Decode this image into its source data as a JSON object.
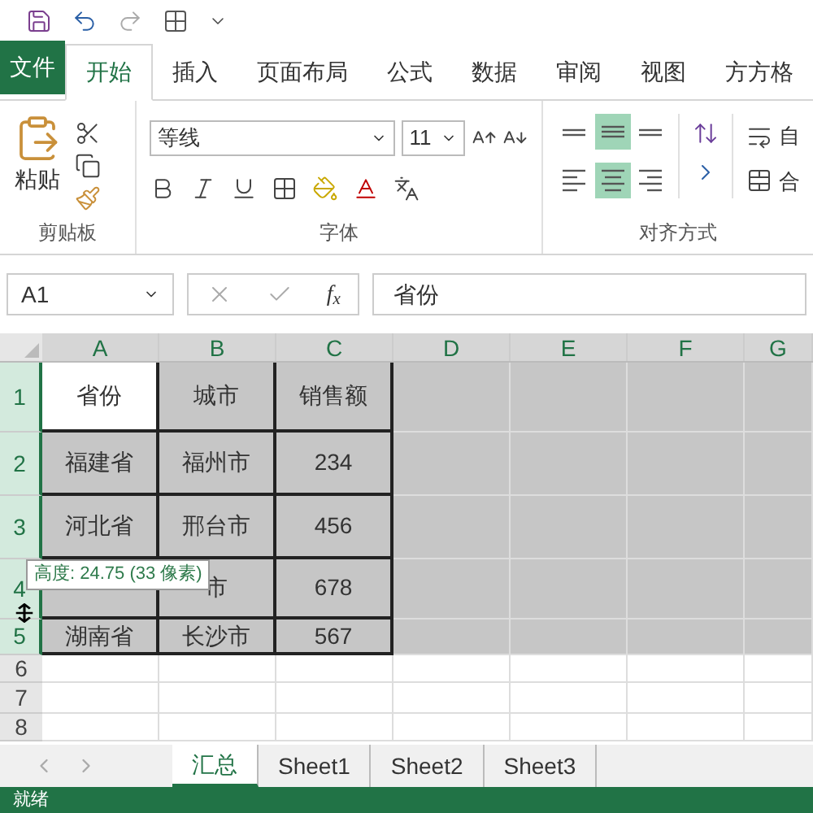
{
  "ribbon_tabs": [
    {
      "label": "文件",
      "kind": "file",
      "selected": false
    },
    {
      "label": "开始",
      "kind": "tab",
      "selected": true
    },
    {
      "label": "插入",
      "kind": "tab",
      "selected": false
    },
    {
      "label": "页面布局",
      "kind": "tab",
      "selected": false
    },
    {
      "label": "公式",
      "kind": "tab",
      "selected": false
    },
    {
      "label": "数据",
      "kind": "tab",
      "selected": false
    },
    {
      "label": "审阅",
      "kind": "tab",
      "selected": false
    },
    {
      "label": "视图",
      "kind": "tab",
      "selected": false
    },
    {
      "label": "方方格",
      "kind": "tab",
      "selected": false
    }
  ],
  "clipboard": {
    "paste_label": "粘贴",
    "group_label": "剪贴板"
  },
  "font": {
    "name": "等线",
    "size": "11",
    "group_label": "字体"
  },
  "alignment": {
    "group_label": "对齐方式",
    "wrap_label": "自",
    "merge_label": "合",
    "buttons": [
      {
        "kind": "top",
        "selected": false
      },
      {
        "kind": "middle",
        "selected": true
      },
      {
        "kind": "bottom",
        "selected": false
      },
      {
        "kind": "left",
        "selected": false
      },
      {
        "kind": "center",
        "selected": true
      },
      {
        "kind": "right",
        "selected": false
      }
    ]
  },
  "formula_bar": {
    "name_box": "A1",
    "function_label": "f$_{x}$",
    "value": "省份"
  },
  "columns": [
    {
      "label": "A",
      "selected": true
    },
    {
      "label": "B",
      "selected": true
    },
    {
      "label": "C",
      "selected": true
    },
    {
      "label": "D",
      "selected": true
    },
    {
      "label": "E",
      "selected": true
    },
    {
      "label": "F",
      "selected": true
    },
    {
      "label": "G",
      "selected": true
    }
  ],
  "rows": [
    {
      "header": "1",
      "selected": true,
      "cells": [
        "省份",
        "城市",
        "销售额"
      ]
    },
    {
      "header": "2",
      "selected": true,
      "cells": [
        "福建省",
        "福州市",
        "234"
      ]
    },
    {
      "header": "3",
      "selected": true,
      "cells": [
        "河北省",
        "邢台市",
        "456"
      ]
    },
    {
      "header": "4",
      "selected": true,
      "cells": [
        null,
        "市",
        "678"
      ]
    },
    {
      "header": "5",
      "selected": true,
      "cells": [
        "湖南省",
        "长沙市",
        "567"
      ]
    },
    {
      "header": "6",
      "selected": false,
      "cells": []
    },
    {
      "header": "7",
      "selected": false,
      "cells": []
    },
    {
      "header": "8",
      "selected": false,
      "cells": []
    }
  ],
  "tooltip": "高度: 24.75 (33 像素)",
  "sheet_tabs": [
    {
      "label": "汇总",
      "selected": true
    },
    {
      "label": "Sheet1",
      "selected": false
    },
    {
      "label": "Sheet2",
      "selected": false
    },
    {
      "label": "Sheet3",
      "selected": false
    }
  ],
  "status": "就绪"
}
